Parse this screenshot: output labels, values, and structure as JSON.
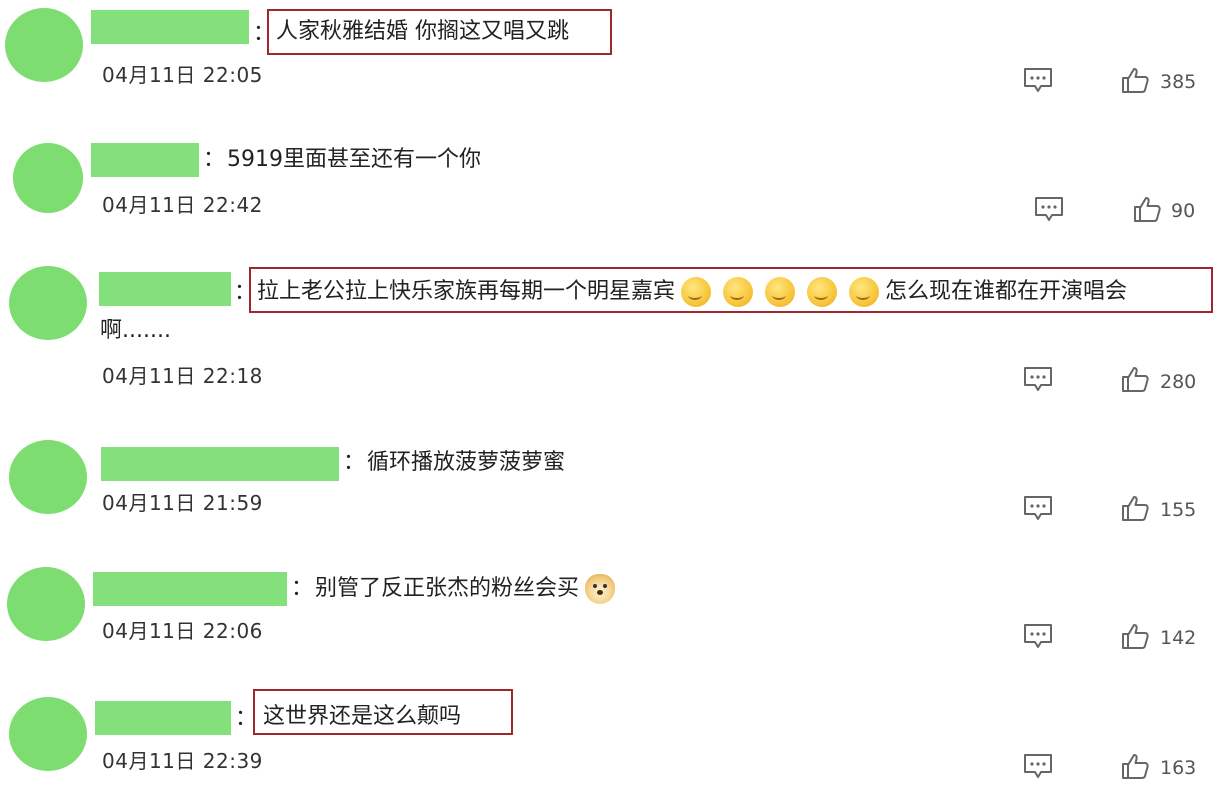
{
  "comments": [
    {
      "text": "人家秋雅结婚 你搁这又唱又跳",
      "timestamp": "04月11日 22:05",
      "likes": "385"
    },
    {
      "text": "5919里面甚至还有一个你",
      "timestamp": "04月11日 22:42",
      "likes": "90"
    },
    {
      "text_before": "拉上老公拉上快乐家族再每期一个明星嘉宾",
      "text_after": "怎么现在谁都在开演唱会",
      "text_wrap": "啊.......",
      "emoji_name": "thinking-emoji",
      "timestamp": "04月11日 22:18",
      "likes": "280"
    },
    {
      "text": "循环播放菠萝菠萝蜜",
      "timestamp": "04月11日 21:59",
      "likes": "155"
    },
    {
      "text": "别管了反正张杰的粉丝会买",
      "emoji_name": "doge-emoji",
      "timestamp": "04月11日 22:06",
      "likes": "142"
    },
    {
      "text": "这世界还是这么颠吗",
      "timestamp": "04月11日 22:39",
      "likes": "163"
    }
  ],
  "colon": "：",
  "colors": {
    "avatar": "#7ddd70",
    "name_redaction": "#84e07a",
    "highlight_box": "#a1262e"
  },
  "icons": {
    "reply": "comment-bubble-icon",
    "like": "thumbs-up-icon"
  }
}
